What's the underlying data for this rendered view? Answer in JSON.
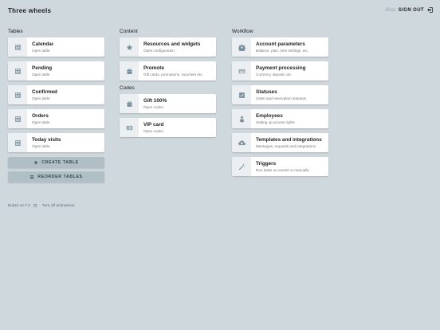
{
  "header": {
    "title": "Three wheels",
    "user": "Alice",
    "sign_out": "SIGN OUT"
  },
  "tables": {
    "title": "Tables",
    "items": [
      {
        "title": "Calendar",
        "subtitle": "Open table",
        "icon": "table-grid-icon"
      },
      {
        "title": "Pending",
        "subtitle": "Open table",
        "icon": "table-grid-icon"
      },
      {
        "title": "Confirmed",
        "subtitle": "Open table",
        "icon": "table-grid-icon"
      },
      {
        "title": "Orders",
        "subtitle": "Open table",
        "icon": "table-grid-icon"
      },
      {
        "title": "Today visits",
        "subtitle": "Open table",
        "icon": "table-grid-icon"
      }
    ],
    "create_label": "CREATE TABLE",
    "reorder_label": "REORDER TABLES"
  },
  "content": {
    "title": "Content",
    "items": [
      {
        "title": "Resources and widgets",
        "subtitle": "Open configuration",
        "icon": "star-icon"
      },
      {
        "title": "Promote",
        "subtitle": "Gift cards, promotions, vouchers etc.",
        "icon": "gift-icon"
      }
    ]
  },
  "codes": {
    "title": "Codes",
    "items": [
      {
        "title": "Gift 100%",
        "subtitle": "Open codes",
        "icon": "gift-icon"
      },
      {
        "title": "VIP card",
        "subtitle": "Open codes",
        "icon": "id-card-icon"
      }
    ]
  },
  "workflow": {
    "title": "Workflow",
    "items": [
      {
        "title": "Account parameters",
        "subtitle": "Balance, plan, time settings, etc.",
        "icon": "gear-icon"
      },
      {
        "title": "Payment processing",
        "subtitle": "Currency, deposit, etc.",
        "icon": "credit-card-icon"
      },
      {
        "title": "Statuses",
        "subtitle": "Order and reservation statuses",
        "icon": "checkbox-icon"
      },
      {
        "title": "Employees",
        "subtitle": "Setting up access rights",
        "icon": "person-icon"
      },
      {
        "title": "Templates and integrations",
        "subtitle": "Messages, requests and integrations",
        "icon": "cloud-upload-icon"
      },
      {
        "title": "Triggers",
        "subtitle": "Run tasks on events or manually",
        "icon": "magic-wand-icon"
      }
    ]
  },
  "footer": {
    "version": "Bukza v4.7.3",
    "toggle_animations": "Turn off animations"
  },
  "colors": {
    "background": "#cfd8dc",
    "card": "#ffffff",
    "icon_tile": "#eceff1",
    "button": "#b0bec5"
  }
}
